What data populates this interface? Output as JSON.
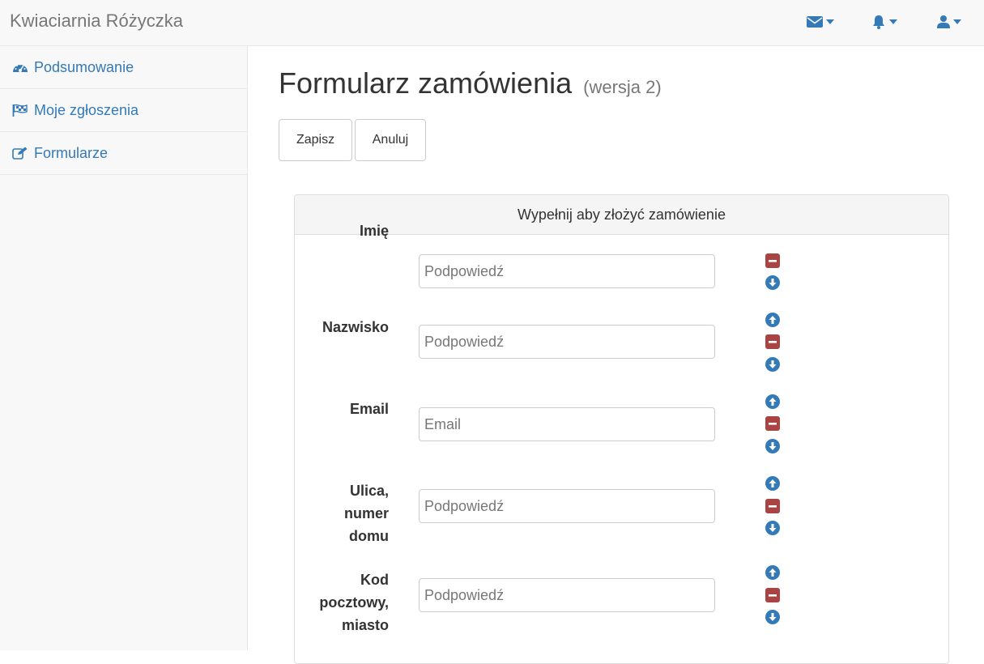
{
  "navbar": {
    "brand": "Kwiaciarnia Różyczka",
    "icons": [
      "envelope-icon",
      "bell-icon",
      "user-icon"
    ],
    "accent": "#337ab7"
  },
  "sidebar": {
    "items": [
      {
        "label": "Podsumowanie",
        "icon": "dashboard-icon"
      },
      {
        "label": "Moje zgłoszenia",
        "icon": "flag-checkered-icon"
      },
      {
        "label": "Formularze",
        "icon": "edit-icon"
      }
    ]
  },
  "page": {
    "title": "Formularz zamówienia",
    "version": "(wersja 2)",
    "save_label": "Zapisz",
    "cancel_label": "Anuluj"
  },
  "form": {
    "heading": "Wypełnij aby złożyć zamówienie",
    "fields": [
      {
        "label": "Imię",
        "placeholder": "Podpowiedź",
        "value": ""
      },
      {
        "label": "Nazwisko",
        "placeholder": "Podpowiedź",
        "value": ""
      },
      {
        "label": "Email",
        "placeholder": "Email",
        "value": ""
      },
      {
        "label": "Ulica, numer domu",
        "placeholder": "Podpowiedź",
        "value": ""
      },
      {
        "label": "Kod pocztowy, miasto",
        "placeholder": "Podpowiedź",
        "value": ""
      }
    ],
    "colors": {
      "remove": "#a94442",
      "move": "#337ab7"
    }
  }
}
